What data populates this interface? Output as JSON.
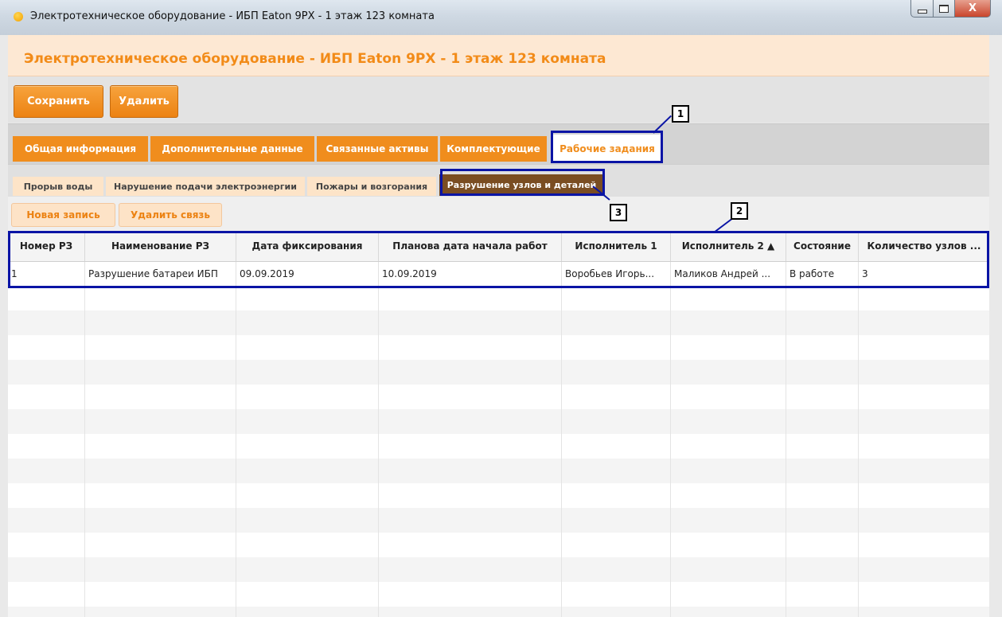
{
  "window": {
    "title": "Электротехническое оборудование - ИБП Eaton 9PX - 1 этаж 123 комната",
    "close_glyph": "X"
  },
  "header": {
    "title": "Электротехническое оборудование - ИБП Eaton 9PX - 1 этаж 123 комната"
  },
  "toolbar": {
    "save_label": "Сохранить",
    "delete_label": "Удалить"
  },
  "tabs": [
    {
      "label": "Общая информация"
    },
    {
      "label": "Дополнительные данные"
    },
    {
      "label": "Связанные активы"
    },
    {
      "label": "Комплектующие"
    },
    {
      "label": "Рабочие задания",
      "active": true
    }
  ],
  "subtabs": [
    {
      "label": "Прорыв воды"
    },
    {
      "label": "Нарушение подачи электроэнергии"
    },
    {
      "label": "Пожары и возгорания"
    },
    {
      "label": "Разрушение узлов и деталей",
      "active": true
    }
  ],
  "actions": {
    "new_label": "Новая запись",
    "unlink_label": "Удалить связь"
  },
  "table": {
    "columns": [
      "Номер РЗ",
      "Наименование РЗ",
      "Дата фиксирования",
      "Планова дата начала работ",
      "Исполнитель 1",
      "Исполнитель 2 ▲",
      "Состояние",
      "Количество узлов ..."
    ],
    "rows": [
      [
        "1",
        "Разрушение батареи ИБП",
        "09.09.2019",
        "10.09.2019",
        "Воробьев Игорь...",
        "Маликов Андрей ...",
        "В работе",
        "3"
      ]
    ]
  },
  "callouts": [
    "1",
    "2",
    "3"
  ],
  "colors": {
    "accent_orange": "#f08d1d",
    "active_subtab": "#7a4d22",
    "highlight_blue": "#0a14a5"
  }
}
